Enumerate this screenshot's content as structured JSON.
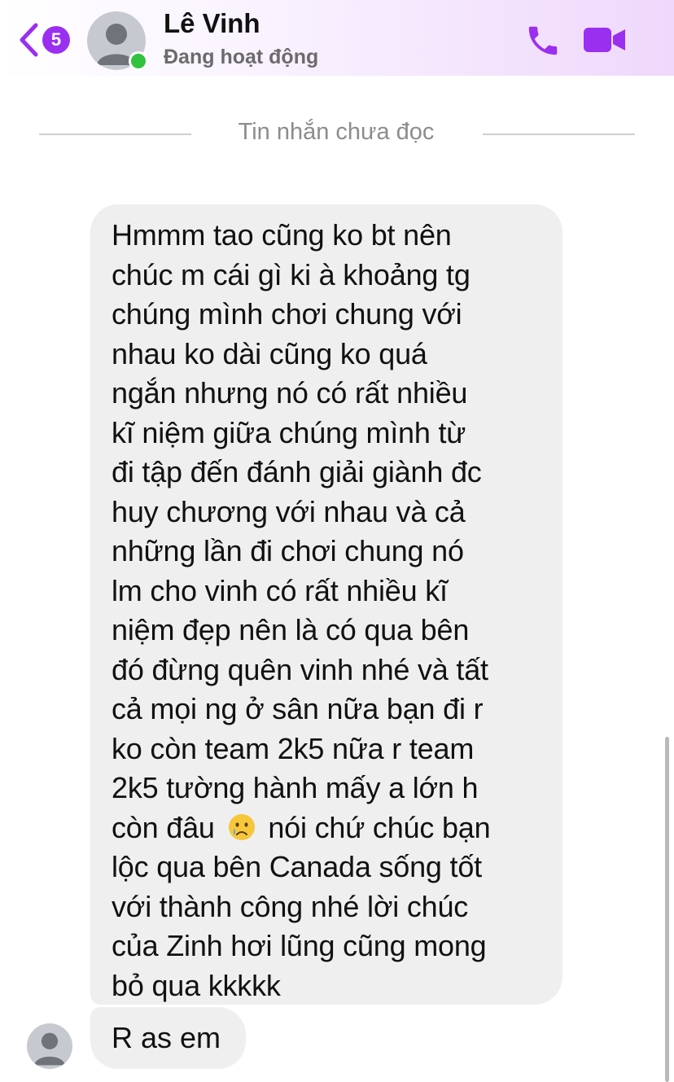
{
  "header": {
    "unread_count": "5",
    "contact_name": "Lê Vinh",
    "contact_status": "Đang hoạt động",
    "accent_color": "#9b2ff0",
    "online_color": "#31c23e",
    "icons": [
      "back-chevron-icon",
      "avatar-placeholder-icon",
      "phone-icon",
      "video-camera-icon"
    ]
  },
  "divider": {
    "label": "Tin nhắn chưa đọc"
  },
  "messages": [
    {
      "lines": [
        "Hmmm tao cũng ko bt nên",
        "chúc m cái gì ki à khoảng tg",
        "chúng mình chơi chung với",
        "nhau ko dài cũng ko quá",
        "ngắn nhưng nó có rất nhiều",
        "kĩ niệm giữa chúng mình từ",
        "đi tập đến đánh giải giành đc",
        "huy chương với nhau và cả",
        "những lần đi chơi chung nó",
        "lm cho vinh có rất nhiều kĩ",
        "niệm đẹp nên là có qua bên",
        "đó đừng quên vinh nhé và tất",
        "cả mọi ng ở sân nữa bạn đi r",
        "ko còn team 2k5 nữa r team",
        "2k5 tường hành mấy a lớn h",
        "còn đâu",
        "lộc qua bên Canada sống tốt",
        "với thành công nhé lời chúc",
        "của Zinh hơi lũng cũng mong",
        "bỏ qua kkkkk"
      ],
      "line16_after_emoji": "nói chứ chúc bạn",
      "emoji": "crying-face-emoji"
    },
    {
      "text": "R as em"
    }
  ]
}
